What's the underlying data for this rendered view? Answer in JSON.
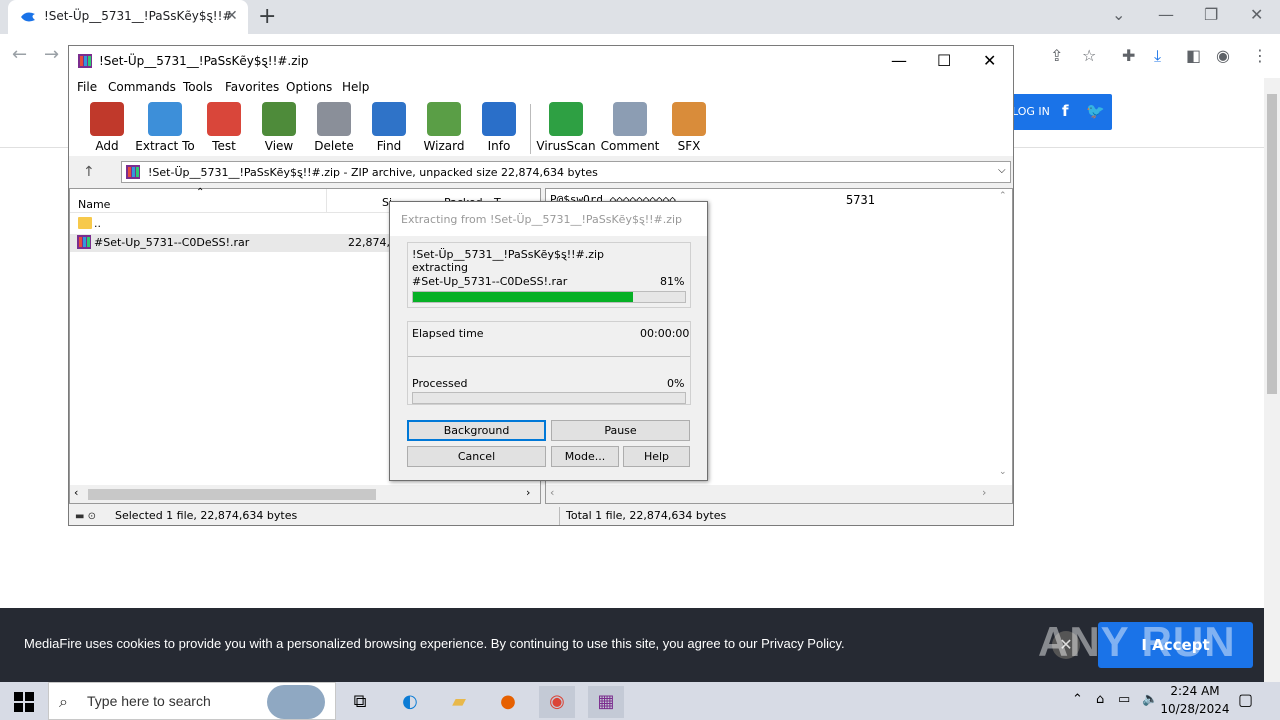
{
  "browser": {
    "tab_title": "!Set-Üp__5731__!PaSsKẽy$ȿ!!#",
    "tab_close": "✕",
    "new_tab": "+",
    "login_label": "LOG IN",
    "fb": "f",
    "tw": "🐦"
  },
  "winrar": {
    "title": "!Set-Üp__5731__!PaSsKẽy$ȿ!!#.zip",
    "menu": [
      "File",
      "Commands",
      "Tools",
      "Favorites",
      "Options",
      "Help"
    ],
    "tools": [
      {
        "label": "Add",
        "color": "#c0392b"
      },
      {
        "label": "Extract To",
        "color": "#3d8fd9"
      },
      {
        "label": "Test",
        "color": "#d9463a"
      },
      {
        "label": "View",
        "color": "#4e8b3a"
      },
      {
        "label": "Delete",
        "color": "#8a8f99"
      },
      {
        "label": "Find",
        "color": "#2f73c8"
      },
      {
        "label": "Wizard",
        "color": "#5a9e46"
      },
      {
        "label": "Info",
        "color": "#2a6fc9"
      },
      {
        "label": "VirusScan",
        "color": "#2ea043"
      },
      {
        "label": "Comment",
        "color": "#8c9db3"
      },
      {
        "label": "SFX",
        "color": "#d98c3a"
      }
    ],
    "path_text": "!Set-Üp__5731__!PaSsKẽy$ȿ!!#.zip - ZIP archive, unpacked size 22,874,634 bytes",
    "columns": {
      "name": "Name",
      "size": "Si",
      "packed": "Packed",
      "type": "T"
    },
    "rows": [
      {
        "name": "..",
        "size": ""
      },
      {
        "name": "#Set-Up_5731--C0DeSS!.rar",
        "size": "22,874,6"
      }
    ],
    "comment_line": "P@$swOrd ◇◇◇◇◇◇◇◇◇◇",
    "comment_value": "5731",
    "status_left": "Selected 1 file, 22,874,634 bytes",
    "status_right": "Total 1 file, 22,874,634 bytes"
  },
  "dialog": {
    "title": "Extracting from !Set-Üp__5731__!PaSsKẽy$ȿ!!#.zip",
    "archive": "!Set-Üp__5731__!PaSsKẽy$ȿ!!#.zip",
    "action": "extracting",
    "file": "#Set-Up_5731--C0DeSS!.rar",
    "file_percent": "81%",
    "file_progress": 0.81,
    "elapsed_label": "Elapsed time",
    "elapsed_value": "00:00:00",
    "processed_label": "Processed",
    "processed_value": "0%",
    "processed_progress": 0.0,
    "buttons": {
      "background": "Background",
      "pause": "Pause",
      "cancel": "Cancel",
      "mode": "Mode...",
      "help": "Help"
    }
  },
  "cookie": {
    "text": "MediaFire uses cookies to provide you with a personalized browsing experience. By continuing to use this site, you agree to our Privacy Policy.",
    "accept": "I Accept",
    "watermark": "ANY RUN"
  },
  "taskbar": {
    "search_placeholder": "Type here to search",
    "time": "2:24 AM",
    "date": "10/28/2024"
  }
}
